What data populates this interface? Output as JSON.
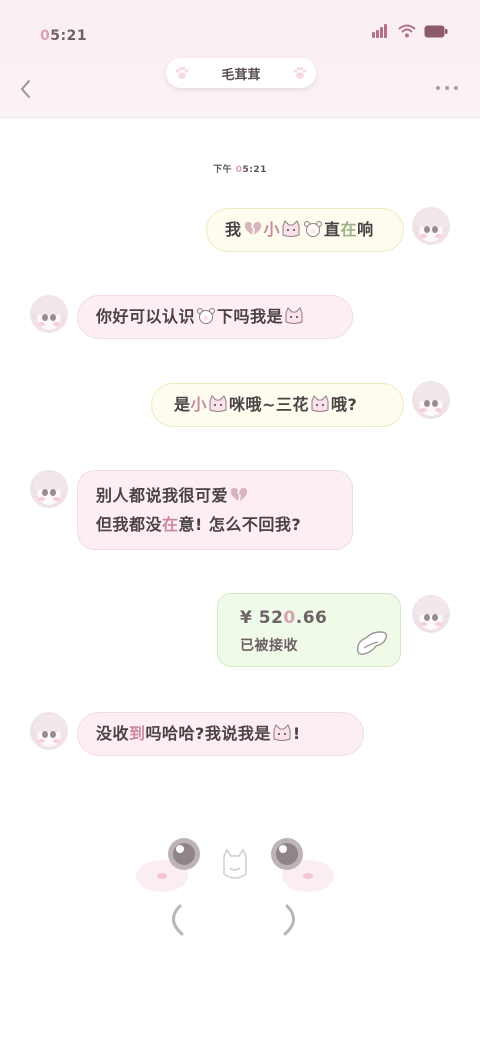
{
  "status_bar": {
    "time_highlight": "0",
    "time_rest": "5:21"
  },
  "header": {
    "title": "毛茸茸",
    "back_icon": "chevron-left-icon",
    "more_icon": "more-dots-icon"
  },
  "chat": {
    "timestamp_prefix": "下午 ",
    "timestamp_highlight": "0",
    "timestamp_rest": "5:21",
    "messages": [
      {
        "side": "right",
        "parts": [
          "我",
          "小",
          "直",
          "在",
          "响"
        ]
      },
      {
        "side": "left",
        "parts": [
          "你好可以认识",
          "下吗我是"
        ]
      },
      {
        "side": "right",
        "parts": [
          "是",
          "小",
          "咪哦~三花",
          "哦?"
        ]
      },
      {
        "side": "left",
        "line1": "别人都说我很可爱",
        "line2_a": "但我都没",
        "line2_b": "在",
        "line2_c": "意! 怎么不回我?"
      },
      {
        "side": "left",
        "parts": [
          "没收",
          "到",
          "吗哈哈?我说我是",
          "!"
        ]
      }
    ]
  },
  "transfer": {
    "currency": "¥ ",
    "amount_a": "52",
    "amount_b": "0",
    "amount_c": ".66",
    "status_a": "已",
    "status_b": "被",
    "status_c": "接收"
  },
  "colors": {
    "accent_pink": "#d9a1b3",
    "left_bubble": "#fceef3",
    "right_bubble": "#fdfcee",
    "transfer_bubble": "#f0fae8"
  }
}
